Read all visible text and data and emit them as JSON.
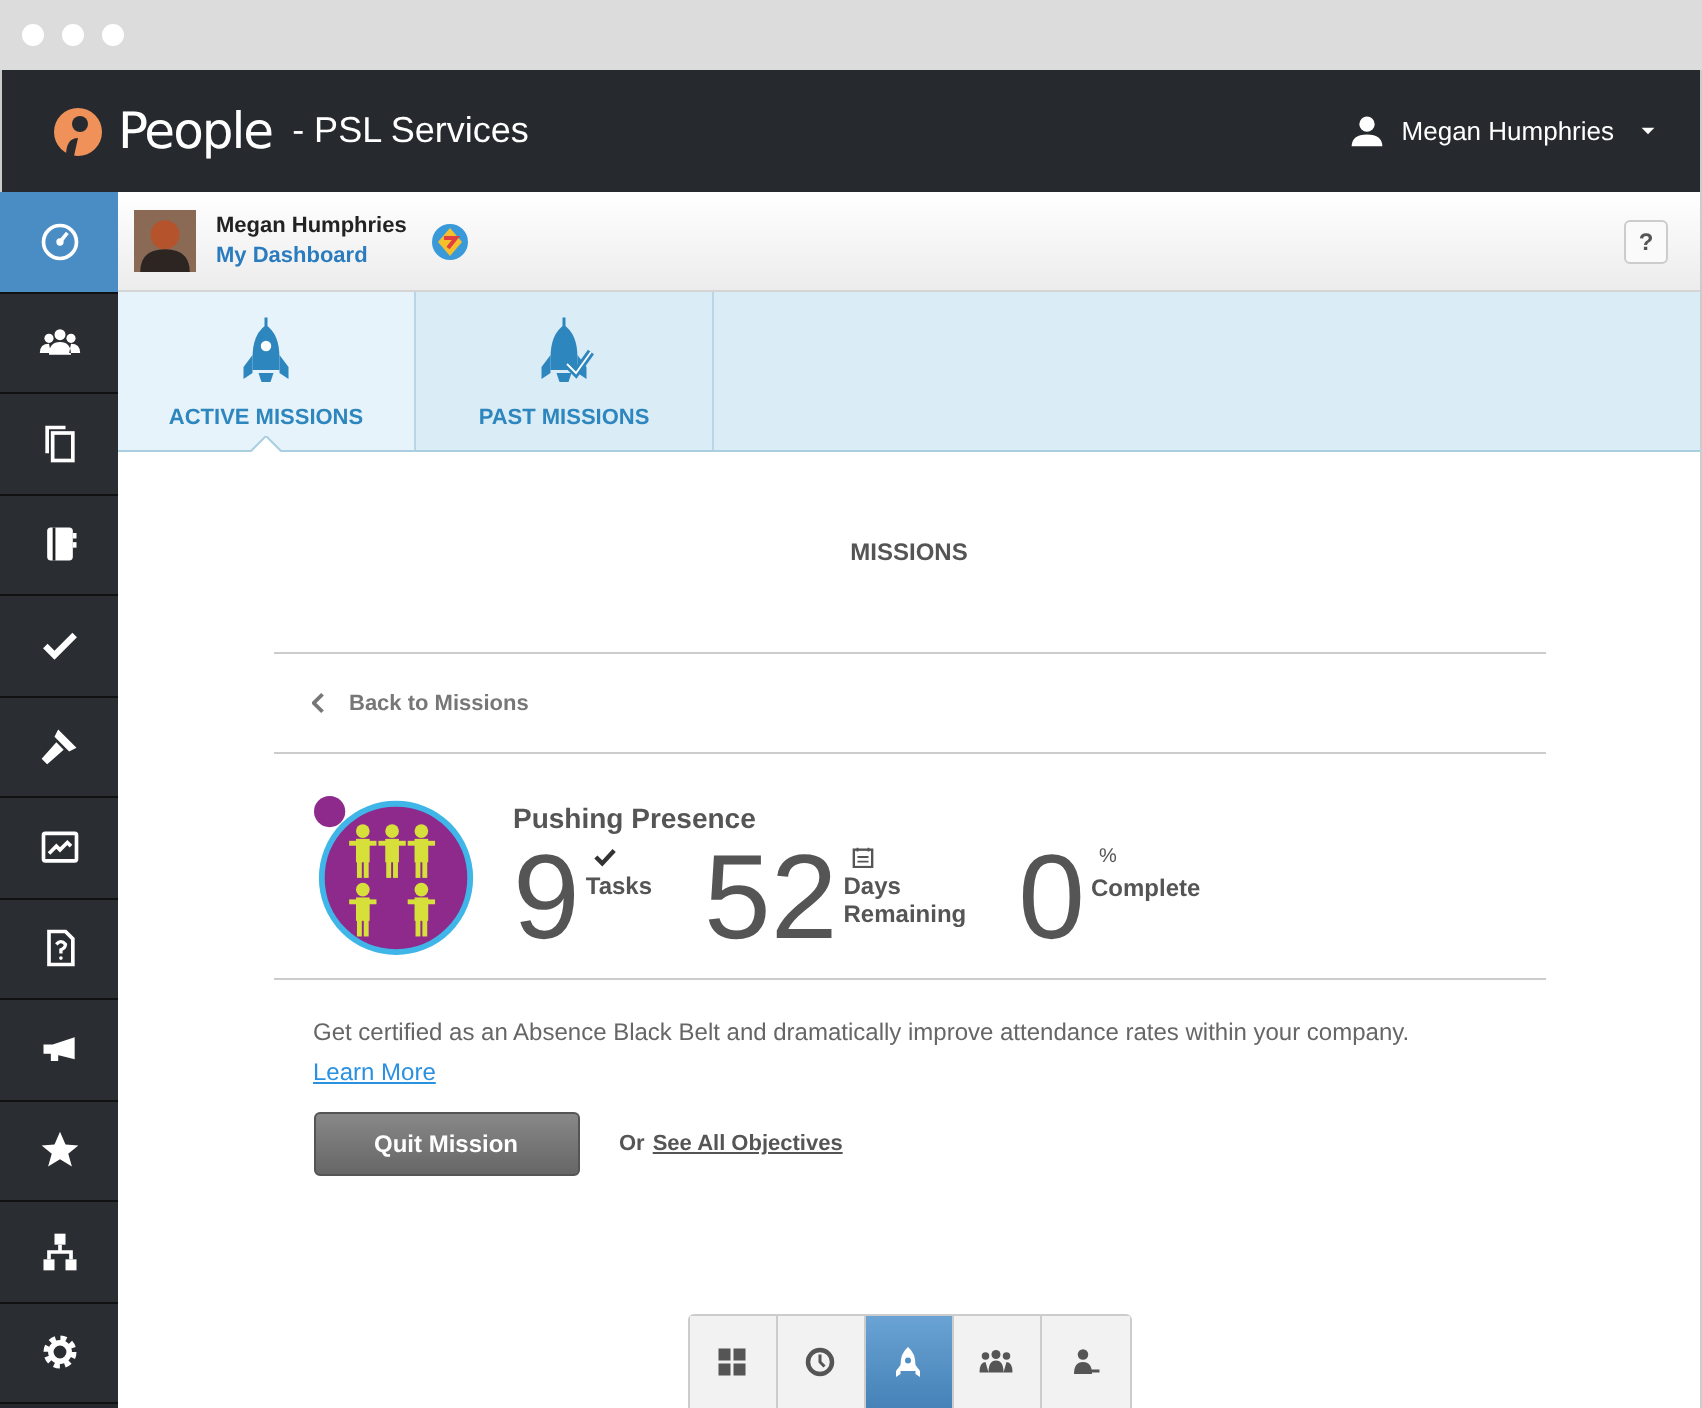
{
  "header": {
    "logo": "People",
    "org": "- PSL Services",
    "user": "Megan Humphries"
  },
  "sidebar": {
    "items": [
      {
        "selected": true
      },
      {
        "selected": false
      },
      {
        "selected": false
      },
      {
        "selected": false
      },
      {
        "selected": false
      },
      {
        "selected": false
      },
      {
        "selected": false
      },
      {
        "selected": false
      },
      {
        "selected": false
      },
      {
        "selected": false
      },
      {
        "selected": false
      },
      {
        "selected": false
      }
    ]
  },
  "user_bar": {
    "name": "Megan Humphries",
    "link": "My Dashboard",
    "help": "?"
  },
  "tabs": [
    {
      "label": "ACTIVE MISSIONS",
      "selected": true
    },
    {
      "label": "PAST MISSIONS",
      "selected": false
    }
  ],
  "page_title": "MISSIONS",
  "back_link": "Back to Missions",
  "mission": {
    "title": "Pushing Presence",
    "stats": [
      {
        "kind": "check",
        "value": "9",
        "label": "Tasks"
      },
      {
        "kind": "calendar",
        "value": "52",
        "label": "Days Remaining"
      },
      {
        "kind": "percent",
        "value": "0",
        "label": "Complete",
        "symbol": "%"
      }
    ],
    "description": "Get certified as an Absence Black Belt and dramatically improve attendance rates within your company.",
    "learn_more": "Learn More",
    "quit_button": "Quit Mission",
    "or": "Or",
    "objectives_link": "See All Objectives"
  },
  "bottom_tabs": [
    {
      "selected": false
    },
    {
      "selected": false
    },
    {
      "selected": true
    },
    {
      "selected": false
    },
    {
      "selected": false
    }
  ]
}
